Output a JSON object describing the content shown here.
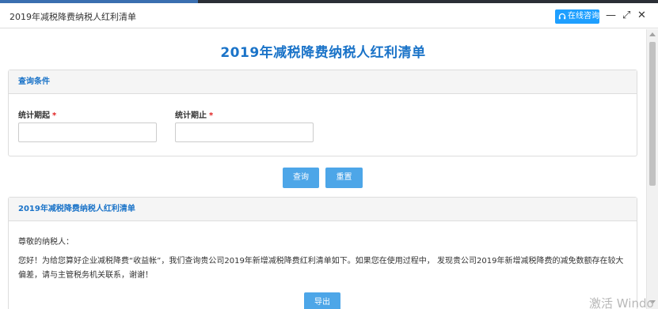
{
  "window": {
    "title": "2019年减税降费纳税人红利清单",
    "consult_label": "在线咨询",
    "minimize_glyph": "—",
    "maximize_glyph": "⤢",
    "close_glyph": "✕"
  },
  "page": {
    "heading": "2019年减税降费纳税人红利清单"
  },
  "query": {
    "panel_title": "查询条件",
    "start_label": "统计期起",
    "end_label": "统计期止",
    "required_mark": "*",
    "start_value": "",
    "end_value": "",
    "search_label": "查询",
    "reset_label": "重置"
  },
  "bonus": {
    "panel_title": "2019年减税降费纳税人红利清单",
    "greeting": "尊敬的纳税人：",
    "message": "您好！为给您算好企业减税降费“收益帐”，我们查询贵公司2019年新增减税降费红利清单如下。如果您在使用过程中， 发现贵公司2019年新增减税降费的减免数额存在较大偏差，请与主管税务机关联系，谢谢！",
    "export_label": "导出"
  },
  "watermark": "激活 Windo",
  "colors": {
    "accent_blue": "#1a73c8",
    "button_blue": "#4da6e8",
    "consult_blue": "#1e9fff",
    "required_red": "#e02020"
  },
  "icons": [
    "headset-icon",
    "minimize-icon",
    "maximize-icon",
    "close-icon"
  ]
}
